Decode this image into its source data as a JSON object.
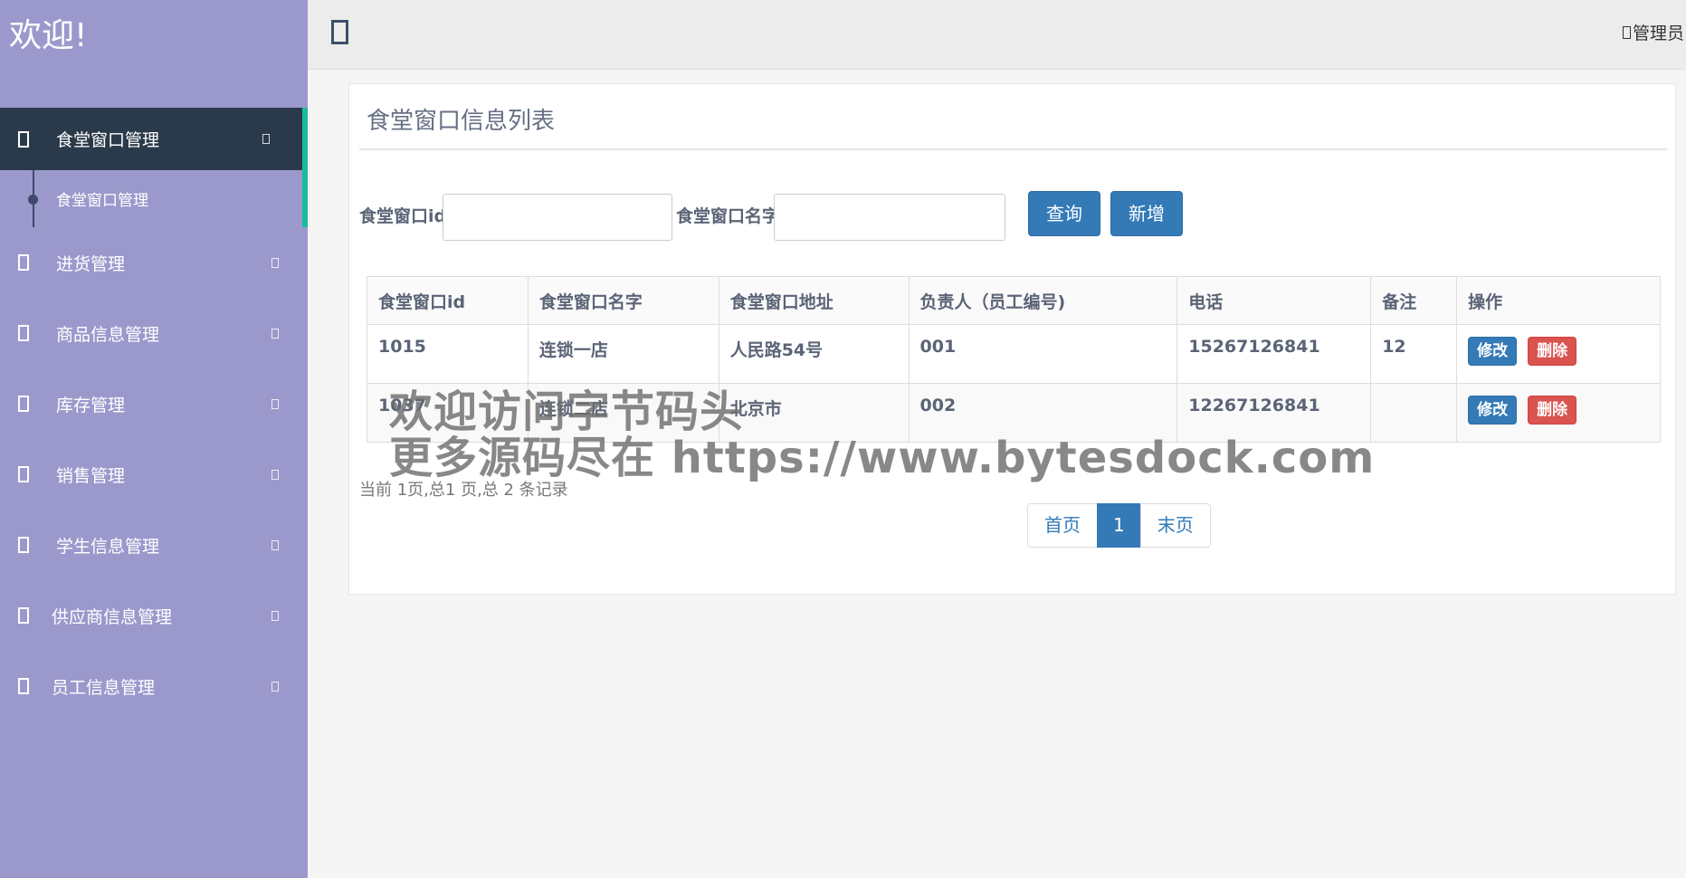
{
  "brand": {
    "welcome": "欢迎!"
  },
  "sidebar": {
    "items": [
      {
        "label": "食堂窗口管理",
        "active": true,
        "children": [
          "食堂窗口管理"
        ]
      },
      {
        "label": "进货管理"
      },
      {
        "label": "商品信息管理"
      },
      {
        "label": "库存管理"
      },
      {
        "label": "销售管理"
      },
      {
        "label": "学生信息管理"
      },
      {
        "label": "供应商信息管理"
      },
      {
        "label": "员工信息管理"
      }
    ]
  },
  "header": {
    "user_label": "管理员"
  },
  "panel": {
    "title": "食堂窗口信息列表",
    "search": {
      "id_label": "食堂窗口id:",
      "id_value": "",
      "name_label": "食堂窗口名字:",
      "name_value": "",
      "query_button": "查询",
      "add_button": "新增"
    },
    "table": {
      "headers": [
        "食堂窗口id",
        "食堂窗口名字",
        "食堂窗口地址",
        "负责人（员工编号)",
        "电话",
        "备注",
        "操作"
      ],
      "rows": [
        [
          "1015",
          "连锁一店",
          "人民路54号",
          "001",
          "15267126841",
          "12"
        ],
        [
          "1037",
          "连锁二店",
          "北京市",
          "002",
          "12267126841",
          ""
        ]
      ],
      "edit_label": "修改",
      "delete_label": "删除"
    },
    "footer_info": "当前 1页,总1 页,总 2 条记录",
    "pagination": {
      "first": "首页",
      "current": "1",
      "last": "末页"
    }
  },
  "watermark": {
    "line1": "欢迎访问字节码头",
    "line2": "更多源码尽在  https://www.bytesdock.com"
  },
  "colors": {
    "sidebar": "#9b99cc",
    "active_nav": "#2b3a4a",
    "accent": "#1abc9c",
    "primary": "#337ab7",
    "danger": "#d9534f"
  }
}
